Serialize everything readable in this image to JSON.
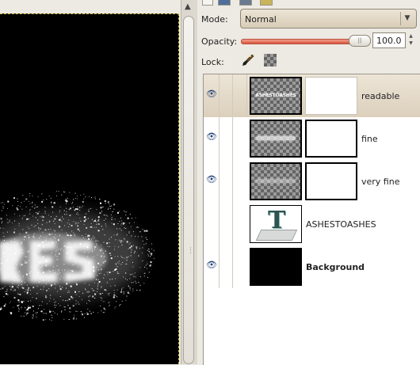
{
  "dock": {
    "mode_label": "Mode:",
    "mode_value": "Normal",
    "opacity_label": "Opacity:",
    "opacity_value": "100.0",
    "opacity_percent": 100,
    "lock_label": "Lock:"
  },
  "layers": [
    {
      "name": "readable",
      "visible": true,
      "selected": true,
      "thumb_text": "ASHESTOASHES"
    },
    {
      "name": "fine",
      "visible": true,
      "selected": false
    },
    {
      "name": "very fine",
      "visible": true,
      "selected": false
    },
    {
      "name": "ASHESTOASHES",
      "visible": false,
      "selected": false
    },
    {
      "name": "Background",
      "visible": true,
      "selected": false
    }
  ],
  "icons": {
    "eye": "eye-icon",
    "paint_lock": "paintbrush-icon",
    "alpha_lock": "checkerboard-icon",
    "text_layer": "text-layer-icon"
  },
  "colors": {
    "selected_row": "#e3d9c6",
    "slider_fill": "#e06a52",
    "canvas": "#000000"
  }
}
